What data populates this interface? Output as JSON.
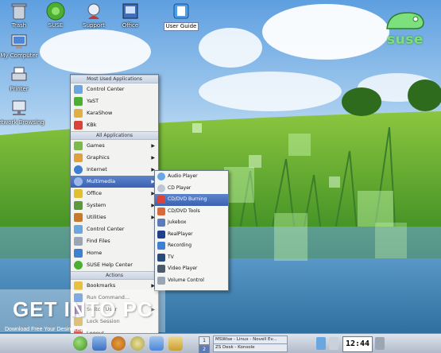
{
  "desktop": {
    "icons": [
      {
        "label": "Trash",
        "icon": "trash-icon"
      },
      {
        "label": "SUSE",
        "icon": "suse-icon"
      },
      {
        "label": "Support",
        "icon": "support-icon"
      },
      {
        "label": "Office",
        "icon": "office-icon"
      },
      {
        "label": "User Guide",
        "icon": "user-guide-icon"
      },
      {
        "label": "My Computer",
        "icon": "my-computer-icon"
      },
      {
        "label": "Printer",
        "icon": "printer-icon"
      },
      {
        "label": "Network Browsing",
        "icon": "network-browsing-icon"
      }
    ],
    "logo_text": "suse"
  },
  "start_menu": {
    "sections": {
      "most_used": "Most Used Applications",
      "all": "All Applications",
      "actions": "Actions"
    },
    "most_used": [
      {
        "label": "Control Center",
        "icon": "control-center-icon"
      },
      {
        "label": "YaST",
        "icon": "yast-icon"
      },
      {
        "label": "KaraShow",
        "icon": "karashow-icon"
      },
      {
        "label": "KBk",
        "icon": "kbk-icon"
      }
    ],
    "all": [
      {
        "label": "Games",
        "icon": "games-icon",
        "submenu": true
      },
      {
        "label": "Graphics",
        "icon": "graphics-icon",
        "submenu": true
      },
      {
        "label": "Internet",
        "icon": "internet-icon",
        "submenu": true
      },
      {
        "label": "Multimedia",
        "icon": "multimedia-icon",
        "submenu": true,
        "active": true
      },
      {
        "label": "Office",
        "icon": "office-menu-icon",
        "submenu": true
      },
      {
        "label": "System",
        "icon": "system-icon",
        "submenu": true
      },
      {
        "label": "Utilities",
        "icon": "utilities-icon",
        "submenu": true
      },
      {
        "label": "Control Center",
        "icon": "control-center-icon",
        "submenu": false
      },
      {
        "label": "Find Files",
        "icon": "find-files-icon",
        "submenu": false
      },
      {
        "label": "Home",
        "icon": "home-icon",
        "submenu": false
      },
      {
        "label": "SUSE Help Center",
        "icon": "help-center-icon",
        "submenu": false
      }
    ],
    "actions": [
      {
        "label": "Bookmarks",
        "icon": "bookmarks-icon",
        "submenu": true
      },
      {
        "label": "Run Command...",
        "icon": "run-command-icon",
        "submenu": false
      },
      {
        "label": "Switch User",
        "icon": "switch-user-icon",
        "submenu": true
      },
      {
        "label": "Lock Session",
        "icon": "lock-session-icon",
        "submenu": false
      },
      {
        "label": "Logout...",
        "icon": "logout-icon",
        "submenu": false
      }
    ]
  },
  "multimedia_submenu": [
    {
      "label": "Audio Player",
      "icon": "audio-player-icon"
    },
    {
      "label": "CD Player",
      "icon": "cd-player-icon"
    },
    {
      "label": "CD/DVD Burning",
      "icon": "cd-burning-icon",
      "active": true
    },
    {
      "label": "CD/DVD Tools",
      "icon": "cd-tools-icon"
    },
    {
      "label": "Jukebox",
      "icon": "jukebox-icon"
    },
    {
      "label": "RealPlayer",
      "icon": "realplayer-icon"
    },
    {
      "label": "Recording",
      "icon": "recording-icon"
    },
    {
      "label": "TV",
      "icon": "tv-icon"
    },
    {
      "label": "Video Player",
      "icon": "video-player-icon"
    },
    {
      "label": "Volume Control",
      "icon": "volume-control-icon"
    }
  ],
  "taskbar": {
    "pager": [
      "1",
      "2"
    ],
    "tasks": [
      "MSWise - Linux - Novell Ev...",
      "ZS Desk - Konsole"
    ],
    "clock": "12:44"
  },
  "watermark": {
    "text": "GET INTO PC",
    "subtext": "Download Free Your Desired App"
  }
}
